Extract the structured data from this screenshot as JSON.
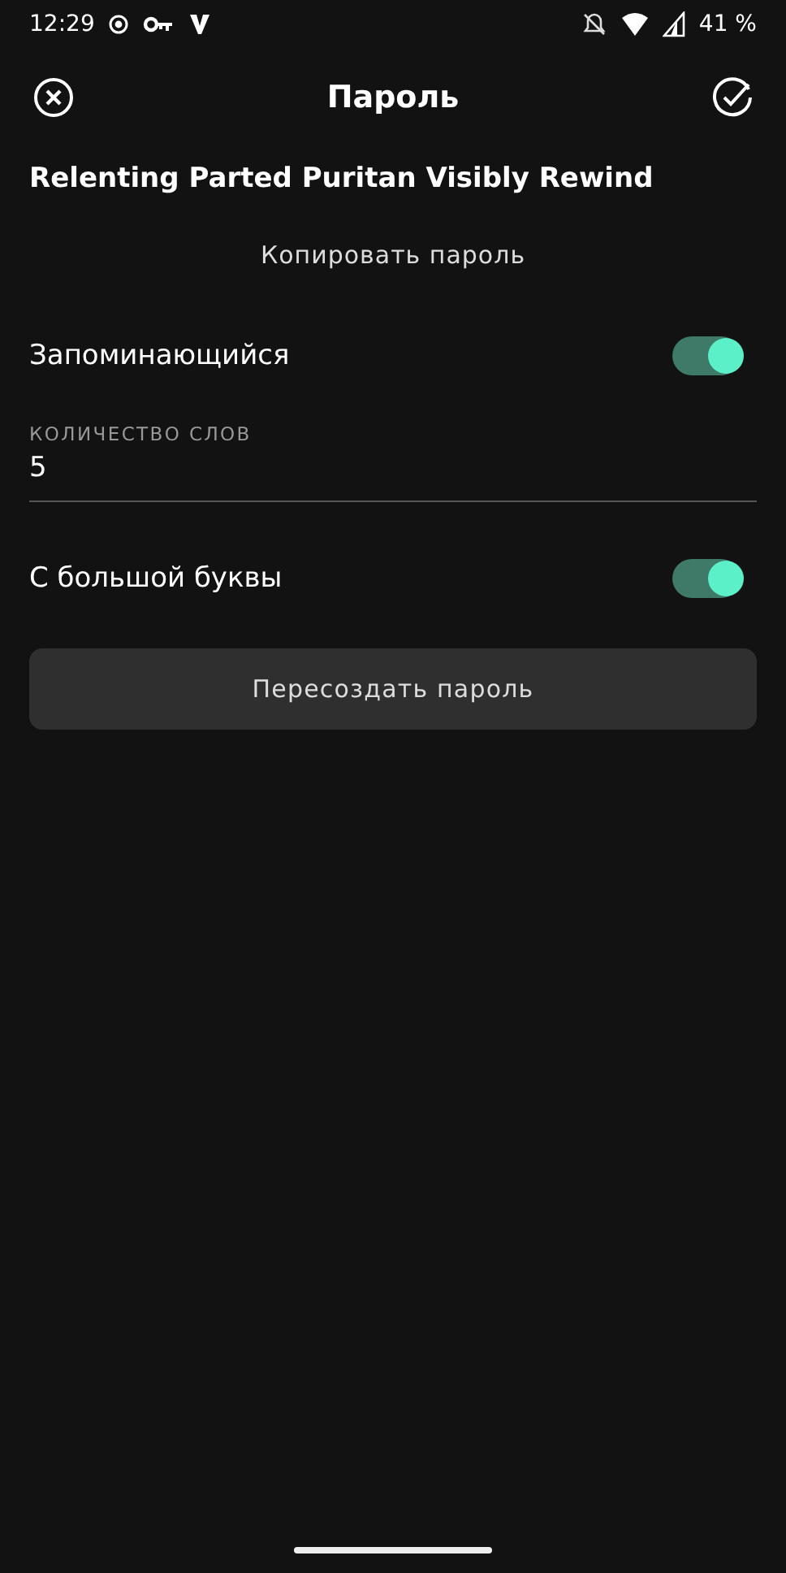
{
  "status_bar": {
    "time": "12:29",
    "battery": "41 %"
  },
  "toolbar": {
    "title": "Пароль"
  },
  "password": "Relenting Parted Puritan Visibly Rewind",
  "copy_button": "Копировать пароль",
  "options": [
    {
      "kind": "switch",
      "label": "Запоминающийся",
      "on": true
    },
    {
      "kind": "field",
      "label": "КОЛИЧЕСТВО СЛОВ",
      "value": "5"
    },
    {
      "kind": "switch",
      "label": "С большой буквы",
      "on": true
    }
  ],
  "regenerate_button": "Пересоздать пароль"
}
